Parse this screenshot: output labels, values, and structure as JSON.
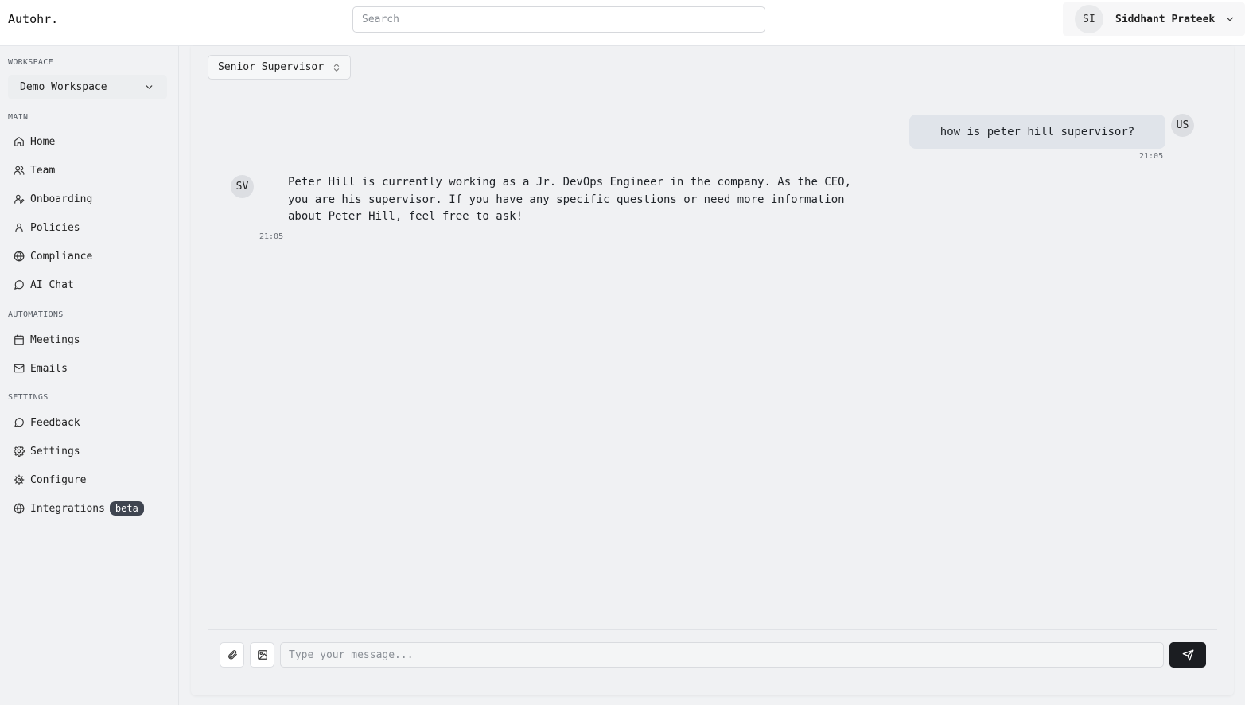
{
  "app": {
    "brand": "Autohr."
  },
  "header": {
    "search_placeholder": "Search",
    "user_initials": "SI",
    "user_name": "Siddhant Prateek"
  },
  "sidebar": {
    "workspace_label": "WORKSPACE",
    "workspace_value": "Demo Workspace",
    "sections": {
      "main": "MAIN",
      "automations": "AUTOMATIONS",
      "settings": "SETTINGS"
    },
    "main_items": [
      {
        "label": "Home",
        "icon": "home-icon"
      },
      {
        "label": "Team",
        "icon": "users-icon"
      },
      {
        "label": "Onboarding",
        "icon": "user-plus-icon"
      },
      {
        "label": "Policies",
        "icon": "user-icon"
      },
      {
        "label": "Compliance",
        "icon": "globe-icon"
      },
      {
        "label": "AI Chat",
        "icon": "message-circle-icon"
      }
    ],
    "automation_items": [
      {
        "label": "Meetings",
        "icon": "calendar-icon"
      },
      {
        "label": "Emails",
        "icon": "mail-icon"
      }
    ],
    "settings_items": [
      {
        "label": "Feedback",
        "icon": "message-circle-icon"
      },
      {
        "label": "Settings",
        "icon": "gear-icon"
      },
      {
        "label": "Configure",
        "icon": "cog-icon"
      },
      {
        "label": "Integrations",
        "icon": "globe-icon",
        "badge": "beta"
      }
    ]
  },
  "chat": {
    "agent_select": "Senior Supervisor",
    "messages": [
      {
        "role": "user",
        "avatar": "US",
        "text": "how is peter hill supervisor?",
        "time": "21:05"
      },
      {
        "role": "assistant",
        "avatar": "SV",
        "text": "Peter Hill is currently working as a Jr. DevOps Engineer in the company. As the CEO, you are his supervisor. If you have any specific questions or need more information about Peter Hill, feel free to ask!",
        "time": "21:05"
      }
    ],
    "input_placeholder": "Type your message..."
  },
  "colors": {
    "accent_dark": "#1b1d21",
    "badge_bg": "#3f4550",
    "user_bubble": "#e0e4ea"
  }
}
